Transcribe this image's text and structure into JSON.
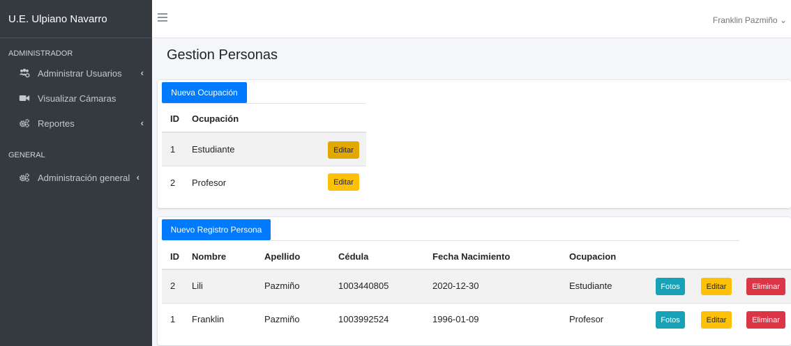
{
  "brand": "U.E. Ulpiano Navarro",
  "sidebar": {
    "section1": "ADMINISTRADOR",
    "items1": [
      {
        "label": "Administrar Usuarios",
        "icon": "users-cog-icon",
        "chevron": "‹"
      },
      {
        "label": "Visualizar Cámaras",
        "icon": "video-camera-icon"
      },
      {
        "label": "Reportes",
        "icon": "cogs-icon",
        "chevron": "‹"
      }
    ],
    "section2": "GENERAL",
    "items2": [
      {
        "label": "Administración general",
        "icon": "cogs-icon",
        "chevron": "‹"
      }
    ]
  },
  "topbar": {
    "user": "Franklin Pazmiño",
    "user_caret": "⌄"
  },
  "page": {
    "title": "Gestion Personas"
  },
  "ocupaciones": {
    "new_button": "Nueva Ocupación",
    "headers": [
      "ID",
      "Ocupación"
    ],
    "rows": [
      {
        "id": "1",
        "ocupacion": "Estudiante",
        "edit": "Editar"
      },
      {
        "id": "2",
        "ocupacion": "Profesor",
        "edit": "Editar"
      }
    ]
  },
  "personas": {
    "new_button": "Nuevo Registro Persona",
    "headers": [
      "ID",
      "Nombre",
      "Apellido",
      "Cédula",
      "Fecha Nacimiento",
      "Ocupacion"
    ],
    "rows": [
      {
        "id": "2",
        "nombre": "Lili",
        "apellido": "Pazmiño",
        "cedula": "1003440805",
        "fecha": "2020-12-30",
        "ocupacion": "Estudiante",
        "fotos": "Fotos",
        "edit": "Editar",
        "delete": "Eliminar"
      },
      {
        "id": "1",
        "nombre": "Franklin",
        "apellido": "Pazmiño",
        "cedula": "1003992524",
        "fecha": "1996-01-09",
        "ocupacion": "Profesor",
        "fotos": "Fotos",
        "edit": "Editar",
        "delete": "Eliminar"
      }
    ]
  },
  "colors": {
    "sidebar": "#343a40",
    "primary": "#007bff",
    "warning": "#ffc107",
    "info": "#17a2b8",
    "danger": "#dc3545"
  }
}
